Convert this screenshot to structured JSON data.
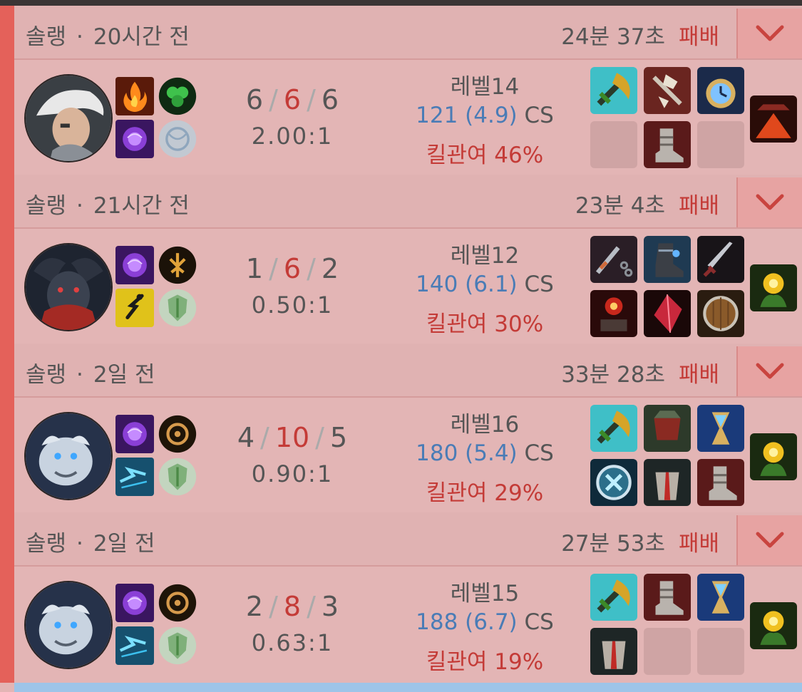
{
  "colors": {
    "loss": "#c43b37",
    "cs": "#4a7cb6",
    "text": "#555555"
  },
  "matches": [
    {
      "queue": "솔랭",
      "dot": "·",
      "ago": "20시간 전",
      "duration": "24분 37초",
      "result": "패배",
      "champion_icon": "silver-hair-champion-portrait",
      "spells": [
        "ignite-spell-icon",
        "ghost-shield-spell-icon"
      ],
      "runes": [
        "green-leaf-rune-icon",
        "grey-orb-rune-icon"
      ],
      "kills": "6",
      "deaths": "6",
      "assists": "6",
      "slash": "/",
      "ratio": "2.00:1",
      "level": "레벨14",
      "cs_value": "121 (4.9)",
      "cs_label": "CS",
      "kp": "킬관여 46%",
      "items": [
        "teal-hammer-item-icon",
        "spiked-axe-item-icon",
        "pocket-watch-item-icon",
        "empty",
        "armored-boots-item-icon",
        "empty"
      ],
      "trinket": "red-lens-trinket-icon"
    },
    {
      "queue": "솔랭",
      "dot": "·",
      "ago": "21시간 전",
      "duration": "23분 4초",
      "result": "패배",
      "champion_icon": "dark-horned-champion-portrait",
      "spells": [
        "purple-spell-icon",
        "flash-runner-spell-icon"
      ],
      "runes": [
        "gold-tree-rune-icon",
        "green-shield-rune-icon"
      ],
      "kills": "1",
      "deaths": "6",
      "assists": "2",
      "slash": "/",
      "ratio": "0.50:1",
      "level": "레벨12",
      "cs_value": "140 (6.1)",
      "cs_label": "CS",
      "kp": "킬관여 30%",
      "items": [
        "chain-flail-item-icon",
        "steel-boots-item-icon",
        "long-dagger-item-icon",
        "red-forge-item-icon",
        "red-crystal-item-icon",
        "wooden-shield-item-icon"
      ],
      "trinket": "yellow-ward-trinket-icon"
    },
    {
      "queue": "솔랭",
      "dot": "·",
      "ago": "2일 전",
      "duration": "33분 28초",
      "result": "패배",
      "champion_icon": "white-beast-champion-portrait",
      "spells": [
        "purple-spell-icon",
        "blue-dash-spell-icon"
      ],
      "runes": [
        "bronze-compass-rune-icon",
        "green-shield-rune-icon"
      ],
      "kills": "4",
      "deaths": "10",
      "assists": "5",
      "slash": "/",
      "ratio": "0.90:1",
      "level": "레벨16",
      "cs_value": "180 (5.4)",
      "cs_label": "CS",
      "kp": "킬관여 29%",
      "items": [
        "teal-hammer-item-icon",
        "red-plate-armor-item-icon",
        "hourglass-item-icon",
        "blue-rune-shield-item-icon",
        "caped-knight-item-icon",
        "armored-boots-item-icon"
      ],
      "trinket": "yellow-ward-trinket-icon"
    },
    {
      "queue": "솔랭",
      "dot": "·",
      "ago": "2일 전",
      "duration": "27분 53초",
      "result": "패배",
      "champion_icon": "white-beast-champion-portrait",
      "spells": [
        "purple-spell-icon",
        "blue-dash-spell-icon"
      ],
      "runes": [
        "bronze-compass-rune-icon",
        "green-shield-rune-icon"
      ],
      "kills": "2",
      "deaths": "8",
      "assists": "3",
      "slash": "/",
      "ratio": "0.63:1",
      "level": "레벨15",
      "cs_value": "188 (6.7)",
      "cs_label": "CS",
      "kp": "킬관여 19%",
      "items": [
        "teal-hammer-item-icon",
        "armored-boots-item-icon",
        "hourglass-item-icon",
        "caped-knight-item-icon",
        "empty",
        "empty"
      ],
      "trinket": "yellow-ward-trinket-icon"
    }
  ]
}
